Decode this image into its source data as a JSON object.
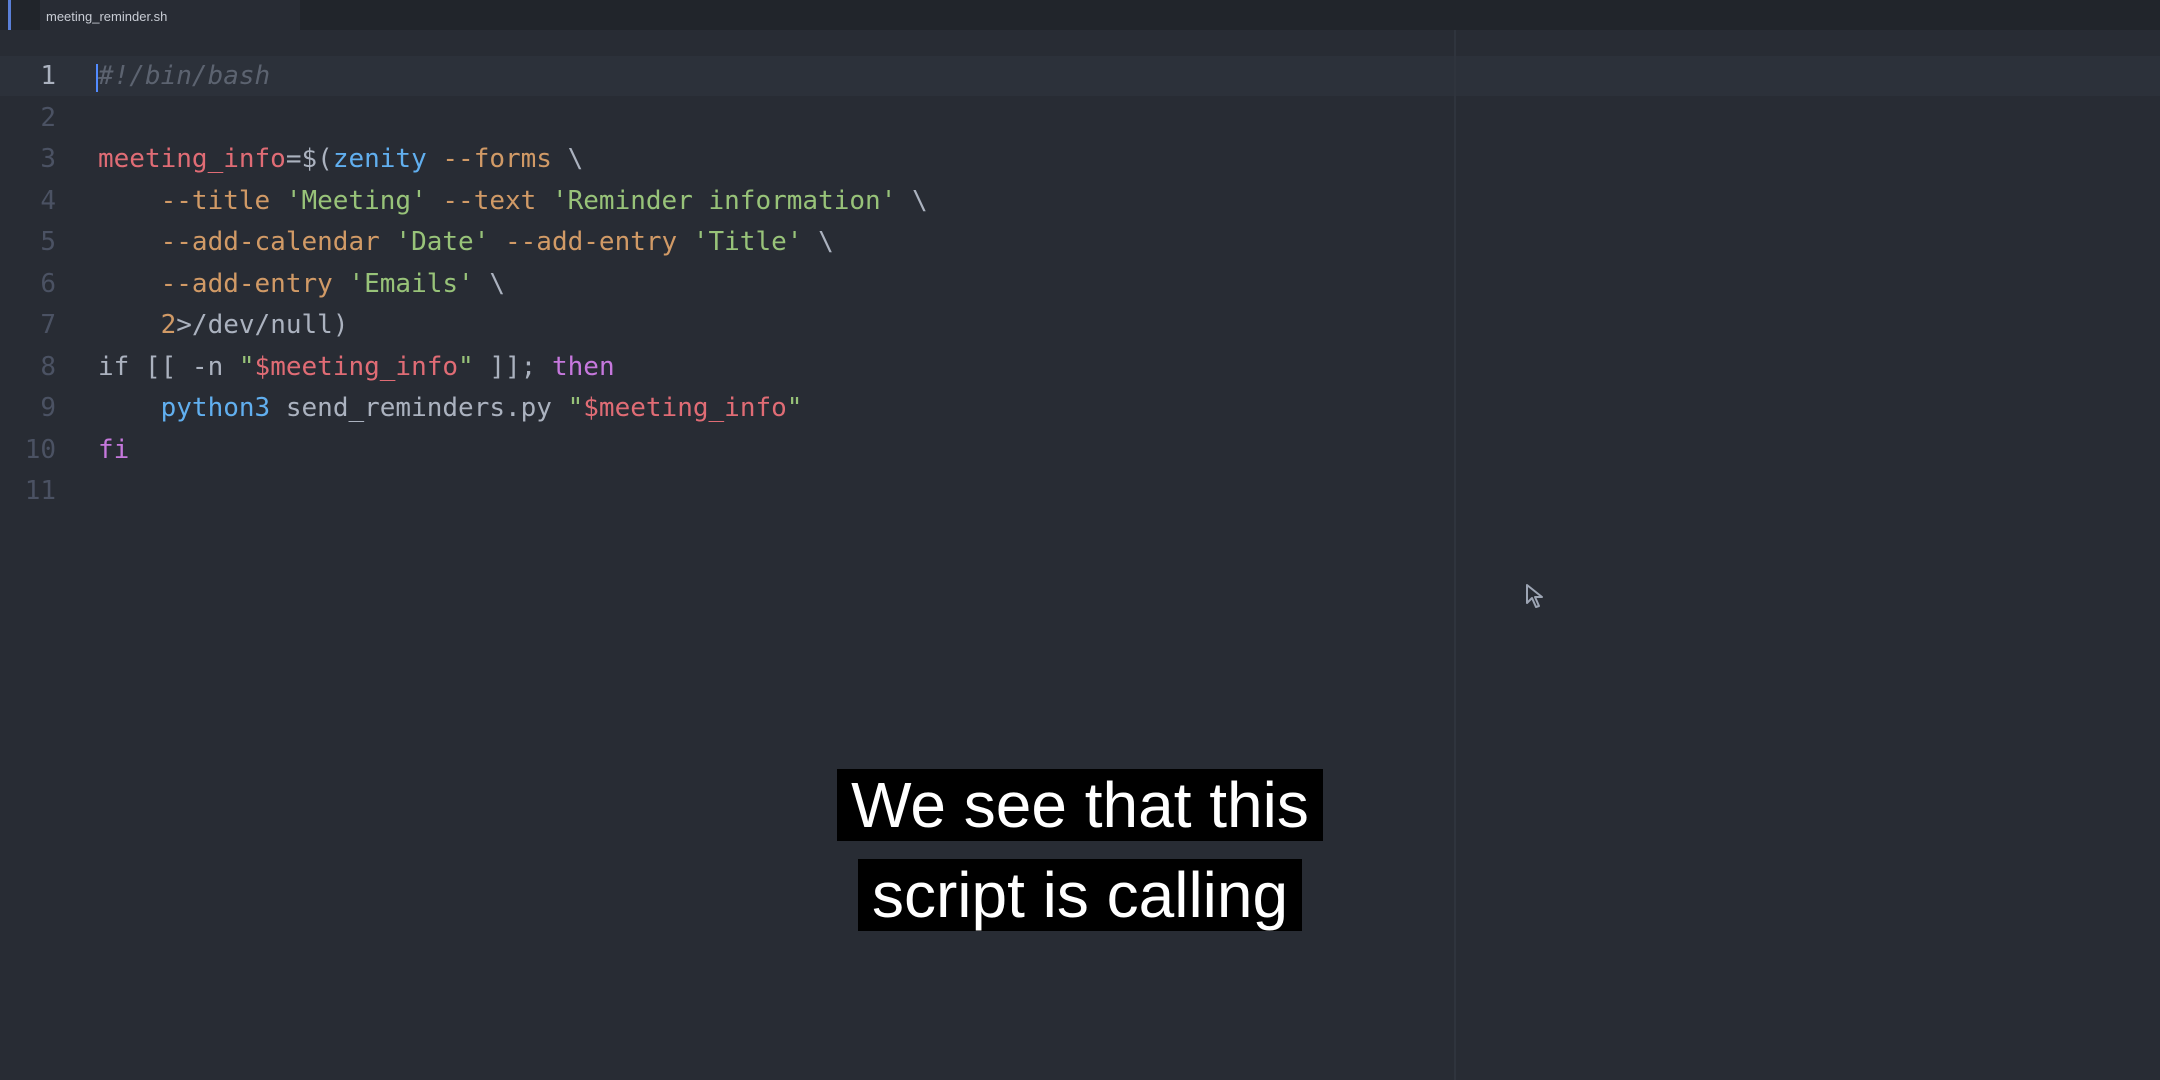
{
  "window": {
    "tab_title": "meeting_reminder.sh"
  },
  "editor": {
    "line_numbers": [
      "1",
      "2",
      "3",
      "4",
      "5",
      "6",
      "7",
      "8",
      "9",
      "10",
      "11"
    ],
    "lines": [
      {
        "tokens": [
          {
            "t": "#!/bin/bash",
            "c": "comment"
          }
        ]
      },
      {
        "tokens": []
      },
      {
        "tokens": [
          {
            "t": "meeting_info",
            "c": "var"
          },
          {
            "t": "=$(",
            "c": "plain"
          },
          {
            "t": "zenity",
            "c": "cmd"
          },
          {
            "t": " --forms ",
            "c": "opt"
          },
          {
            "t": "\\",
            "c": "plain"
          }
        ]
      },
      {
        "tokens": [
          {
            "t": "    --title ",
            "c": "opt"
          },
          {
            "t": "'Meeting'",
            "c": "str"
          },
          {
            "t": " --text ",
            "c": "opt"
          },
          {
            "t": "'Reminder information'",
            "c": "str"
          },
          {
            "t": " \\",
            "c": "plain"
          }
        ]
      },
      {
        "tokens": [
          {
            "t": "    --add-calendar ",
            "c": "opt"
          },
          {
            "t": "'Date'",
            "c": "str"
          },
          {
            "t": " --add-entry ",
            "c": "opt"
          },
          {
            "t": "'Title'",
            "c": "str"
          },
          {
            "t": " \\",
            "c": "plain"
          }
        ]
      },
      {
        "tokens": [
          {
            "t": "    --add-entry ",
            "c": "opt"
          },
          {
            "t": "'Emails'",
            "c": "str"
          },
          {
            "t": " \\",
            "c": "plain"
          }
        ]
      },
      {
        "tokens": [
          {
            "t": "    ",
            "c": "plain"
          },
          {
            "t": "2",
            "c": "num"
          },
          {
            "t": ">/dev/null)",
            "c": "plain"
          }
        ]
      },
      {
        "tokens": [
          {
            "t": "if [[ -n ",
            "c": "plain"
          },
          {
            "t": "\"",
            "c": "str"
          },
          {
            "t": "$meeting_info",
            "c": "var"
          },
          {
            "t": "\"",
            "c": "str"
          },
          {
            "t": " ]]; ",
            "c": "plain"
          },
          {
            "t": "then",
            "c": "kw"
          }
        ]
      },
      {
        "tokens": [
          {
            "t": "    ",
            "c": "plain"
          },
          {
            "t": "python3",
            "c": "cmd"
          },
          {
            "t": " send_reminders.py ",
            "c": "plain"
          },
          {
            "t": "\"",
            "c": "str"
          },
          {
            "t": "$meeting_info",
            "c": "var"
          },
          {
            "t": "\"",
            "c": "str"
          }
        ]
      },
      {
        "tokens": [
          {
            "t": "fi",
            "c": "kw"
          }
        ]
      },
      {
        "tokens": []
      }
    ]
  },
  "caption": {
    "line1": "We see that this",
    "line2": "script is calling"
  },
  "colors": {
    "background": "#282c34",
    "caption_bg": "#000000",
    "caption_text": "#ffffff"
  },
  "icons": {
    "mouse_pointer": "mouse-pointer-icon"
  }
}
